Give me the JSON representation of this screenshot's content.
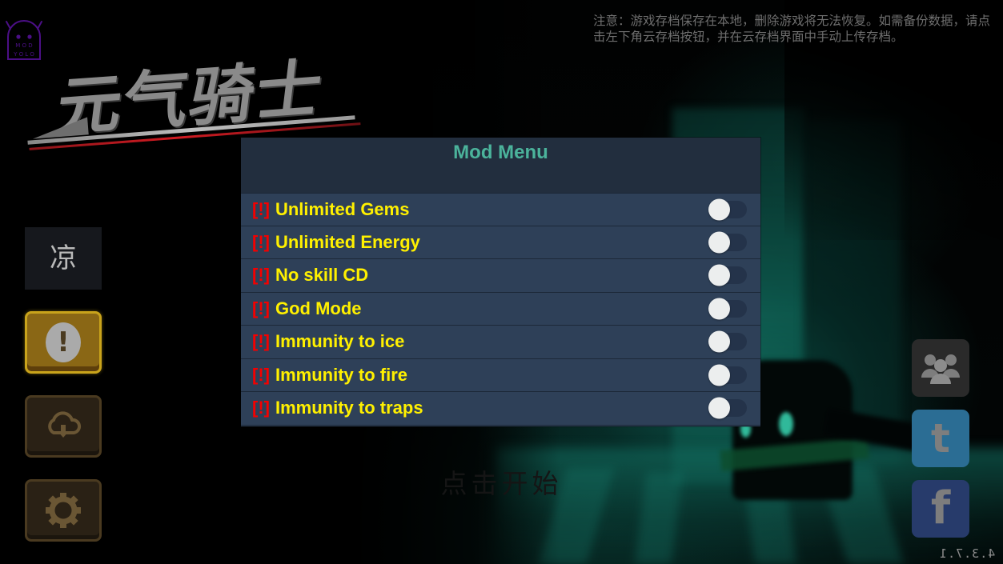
{
  "app": {
    "game_title": "元气骑士",
    "version": "4.3.7.1",
    "click_to_start": "点击开始",
    "watermark": {
      "line1": "M O D",
      "line2": "Y O L O"
    }
  },
  "warning": {
    "text": "注意：游戏存档保存在本地，删除游戏将无法恢复。如需备份数据，请点击左下角云存档按钮，并在云存档界面中手动上传存档。"
  },
  "sidebar": {
    "items": [
      {
        "name": "language-button",
        "label": "凉",
        "type": "plain"
      },
      {
        "name": "notice-button",
        "label": "!",
        "type": "frame-active"
      },
      {
        "name": "cloud-save-button",
        "label": "cloud-download-icon",
        "type": "frame"
      },
      {
        "name": "settings-button",
        "label": "gear-icon",
        "type": "frame"
      }
    ]
  },
  "social": {
    "items": [
      {
        "name": "friends-button",
        "label": "friends-icon",
        "color": "#2a2a2a"
      },
      {
        "name": "twitter-button",
        "label": "t",
        "color": "#2b6d94"
      },
      {
        "name": "facebook-button",
        "label": "f",
        "color": "#273b6b"
      }
    ]
  },
  "mod_menu": {
    "title": "Mod Menu",
    "title_color": "#4bb39b",
    "panel_bg": "#2e4058",
    "header_bg": "#222e3e",
    "label_color": "#fff000",
    "warn_color": "#f40000",
    "warn_prefix": "[!]",
    "rows": [
      {
        "label": "Unlimited Gems",
        "enabled": false
      },
      {
        "label": "Unlimited Energy",
        "enabled": false
      },
      {
        "label": "No skill CD",
        "enabled": false
      },
      {
        "label": "God Mode",
        "enabled": false
      },
      {
        "label": "Immunity to ice",
        "enabled": false
      },
      {
        "label": "Immunity to fire",
        "enabled": false
      },
      {
        "label": "Immunity to traps",
        "enabled": false
      }
    ]
  }
}
